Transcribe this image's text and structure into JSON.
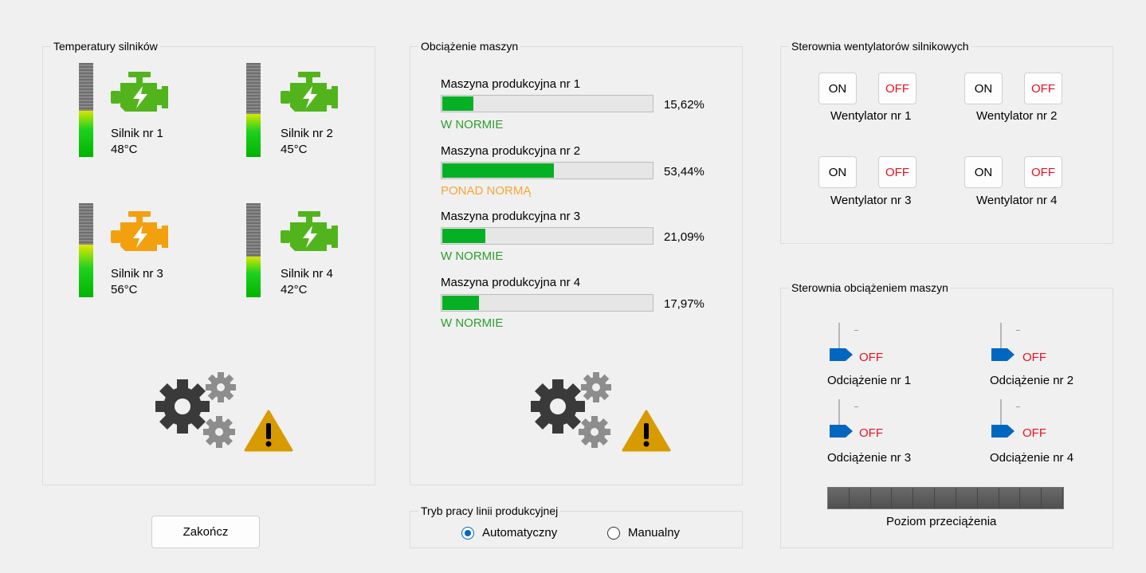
{
  "engines_group": {
    "title": "Temperatury silników",
    "engines": [
      {
        "name": "Silnik nr 1",
        "temp": "48°C",
        "level": 0.49,
        "color": "#52b41c"
      },
      {
        "name": "Silnik nr 2",
        "temp": "45°C",
        "level": 0.46,
        "color": "#52b41c"
      },
      {
        "name": "Silnik nr 3",
        "temp": "56°C",
        "level": 0.56,
        "color": "#f3a00e"
      },
      {
        "name": "Silnik nr 4",
        "temp": "42°C",
        "level": 0.43,
        "color": "#52b41c"
      }
    ]
  },
  "load_group": {
    "title": "Obciążenie maszyn",
    "machines": [
      {
        "name": "Maszyna produkcyjna nr 1",
        "percent": "15,62%",
        "value": 15.62,
        "status": "W NORMIE",
        "status_color": "#2e9e2e"
      },
      {
        "name": "Maszyna produkcyjna nr 2",
        "percent": "53,44%",
        "value": 53.44,
        "status": "PONAD NORMĄ",
        "status_color": "#f3a733"
      },
      {
        "name": "Maszyna produkcyjna nr 3",
        "percent": "21,09%",
        "value": 21.09,
        "status": "W NORMIE",
        "status_color": "#2e9e2e"
      },
      {
        "name": "Maszyna produkcyjna nr 4",
        "percent": "17,97%",
        "value": 17.97,
        "status": "W NORMIE",
        "status_color": "#2e9e2e"
      }
    ]
  },
  "fans_group": {
    "title": "Sterownia wentylatorów silnikowych",
    "on_label": "ON",
    "off_label": "OFF",
    "fans": [
      {
        "name": "Wentylator nr 1"
      },
      {
        "name": "Wentylator nr 2"
      },
      {
        "name": "Wentylator nr 3"
      },
      {
        "name": "Wentylator nr 4"
      }
    ]
  },
  "unload_group": {
    "title": "Sterownia obciążeniem maszyn",
    "switch_state": "OFF",
    "switches": [
      {
        "name": "Odciążenie nr 1"
      },
      {
        "name": "Odciążenie nr 2"
      },
      {
        "name": "Odciążenie nr 3"
      },
      {
        "name": "Odciążenie nr 4"
      }
    ],
    "overload_label": "Poziom przeciążenia",
    "overload_level": 0
  },
  "mode_group": {
    "title": "Tryb pracy linii produkcyjnej",
    "options": [
      "Automatyczny",
      "Manualny"
    ],
    "selected": "Automatyczny"
  },
  "exit_button": "Zakończ",
  "colors": {
    "progress": "#06b025",
    "warning_triangle": "#d79b00",
    "gear_dark": "#3a3a3a",
    "gear_light": "#8d8d8d",
    "slider_blue": "#0067c0",
    "off_red": "#e81123"
  },
  "icons": [
    "engine-icon",
    "gears-icon",
    "warning-icon"
  ]
}
